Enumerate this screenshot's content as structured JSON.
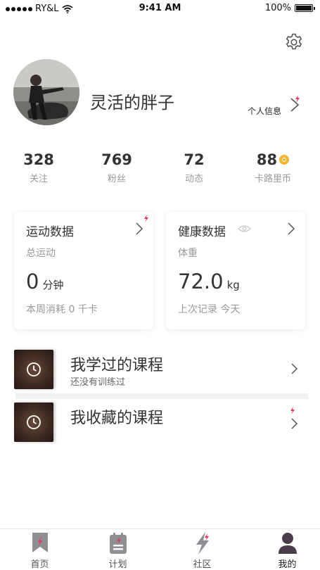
{
  "status_bar": {
    "carrier": "RY&L",
    "time": "9:41 AM",
    "battery": "100%",
    "battery_level": 1.0
  },
  "profile": {
    "name": "灵活的胖子",
    "link_label": "个人信息"
  },
  "stats": [
    {
      "value": "328",
      "label": "关注"
    },
    {
      "value": "769",
      "label": "粉丝"
    },
    {
      "value": "72",
      "label": "动态"
    },
    {
      "value": "88",
      "label": "卡路里币"
    }
  ],
  "cards": {
    "exercise": {
      "title": "运动数据",
      "subtitle": "总运动",
      "value": "0",
      "unit": "分钟",
      "footer": "本周消耗 0 千卡"
    },
    "health": {
      "title": "健康数据",
      "subtitle": "体重",
      "value": "72.0",
      "unit": "kg",
      "footer": "上次记录 今天"
    }
  },
  "courses": [
    {
      "title": "我学过的课程",
      "subtitle": "还没有训练过"
    },
    {
      "title": "我收藏的课程",
      "subtitle": ""
    }
  ],
  "tabs": [
    {
      "label": "首页",
      "icon": "bookmark-icon"
    },
    {
      "label": "计划",
      "icon": "calendar-icon"
    },
    {
      "label": "社区",
      "icon": "lightning-icon"
    },
    {
      "label": "我的",
      "icon": "user-icon"
    }
  ],
  "colors": {
    "accent": "#e8365b",
    "icon_gray": "#8e8e93",
    "active_tab": "#4a3c4a",
    "coin": "#f3b633"
  }
}
